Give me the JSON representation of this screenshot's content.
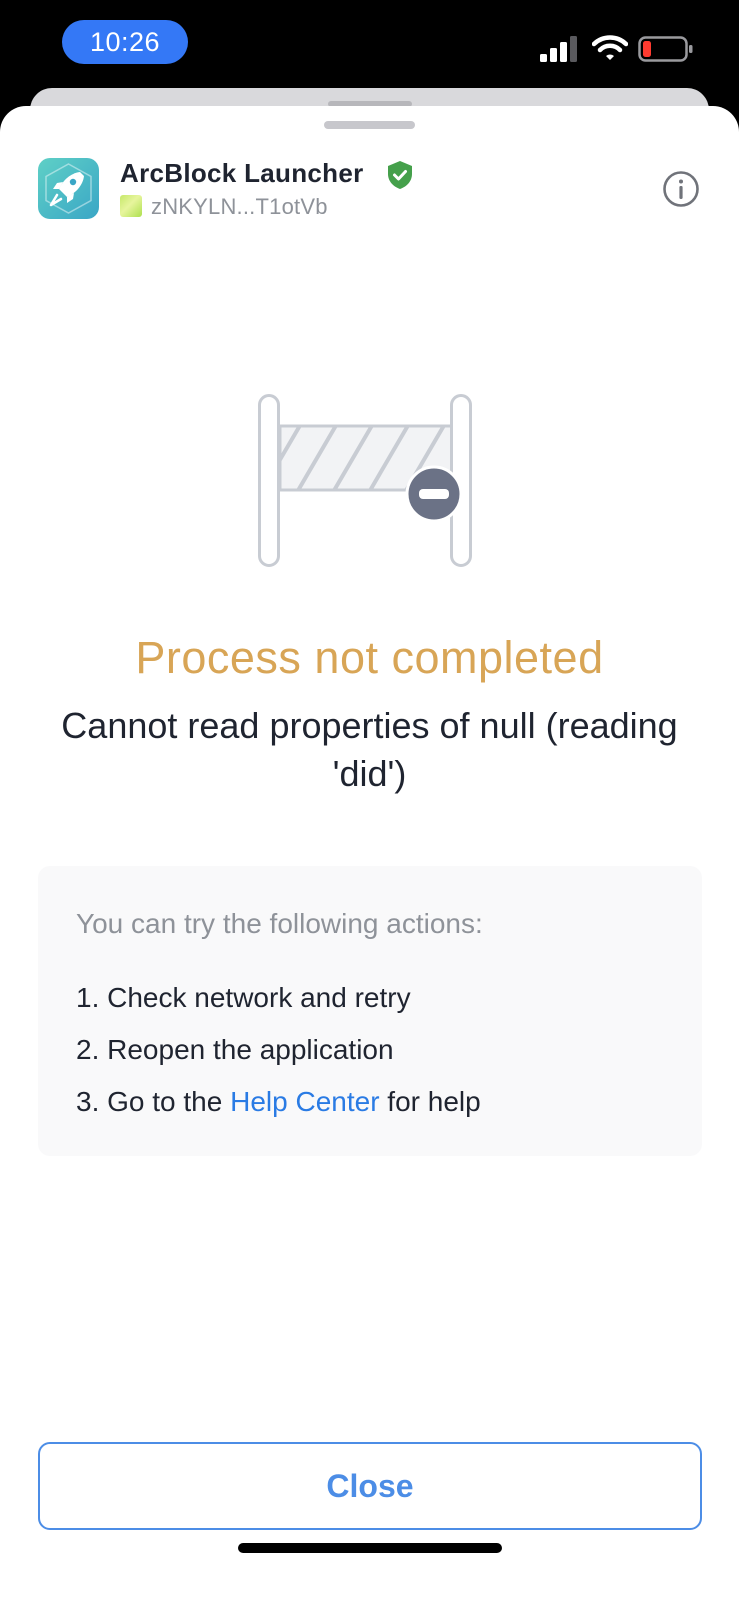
{
  "status_bar": {
    "time": "10:26",
    "icons": [
      "cellular-signal-icon",
      "wifi-icon",
      "battery-low-icon"
    ],
    "battery_color": "#ff3b30"
  },
  "header": {
    "app_name": "ArcBlock Launcher",
    "did": "zNKYLN...T1otVb",
    "verified_icon": "verified-shield-icon",
    "verified_color": "#45a04b",
    "info_icon": "info-icon"
  },
  "status": {
    "illustration_icon": "barrier-gate-icon",
    "title": "Process not completed",
    "title_color": "#d8a556",
    "message": "Cannot read properties of null (reading 'did')"
  },
  "help": {
    "intro": "You can try the following actions:",
    "items": [
      "1. Check network and retry",
      "2. Reopen the application"
    ],
    "item3_prefix": "3. Go to the ",
    "item3_link": "Help Center",
    "item3_suffix": " for help",
    "link_color": "#2a7be4"
  },
  "actions": {
    "close_label": "Close",
    "accent_color": "#4c8de6"
  }
}
